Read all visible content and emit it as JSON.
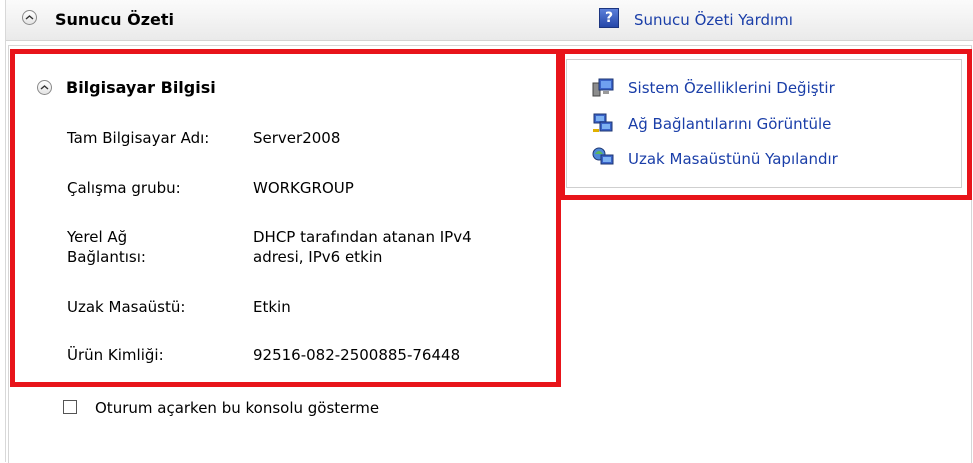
{
  "header": {
    "title": "Sunucu Özeti",
    "help_link": "Sunucu Özeti Yardımı"
  },
  "computer_info": {
    "title": "Bilgisayar Bilgisi",
    "rows": [
      {
        "label": "Tam Bilgisayar Adı:",
        "value": "Server2008"
      },
      {
        "label": "Çalışma grubu:",
        "value": "WORKGROUP"
      },
      {
        "label": "Yerel Ağ Bağlantısı:",
        "label_line1": "Yerel Ağ",
        "label_line2": "Bağlantısı:",
        "value": "DHCP tarafından atanan IPv4 adresi, IPv6 etkin",
        "value_line1": "DHCP tarafından atanan IPv4",
        "value_line2": "adresi, IPv6 etkin"
      },
      {
        "label": "Uzak Masaüstü:",
        "value": "Etkin"
      },
      {
        "label": "Ürün Kimliği:",
        "value": "92516-082-2500885-76448"
      }
    ]
  },
  "tasks": [
    {
      "label": "Sistem Özelliklerini Değiştir",
      "icon": "system-properties-icon"
    },
    {
      "label": "Ağ Bağlantılarını Görüntüle",
      "icon": "network-connections-icon"
    },
    {
      "label": "Uzak Masaüstünü Yapılandır",
      "icon": "remote-desktop-icon"
    }
  ],
  "footer": {
    "checkbox_label": "Oturum açarken bu konsolu gösterme",
    "checked": false
  },
  "colors": {
    "highlight_red": "#e8141a",
    "link_blue": "#1a3ea8"
  }
}
